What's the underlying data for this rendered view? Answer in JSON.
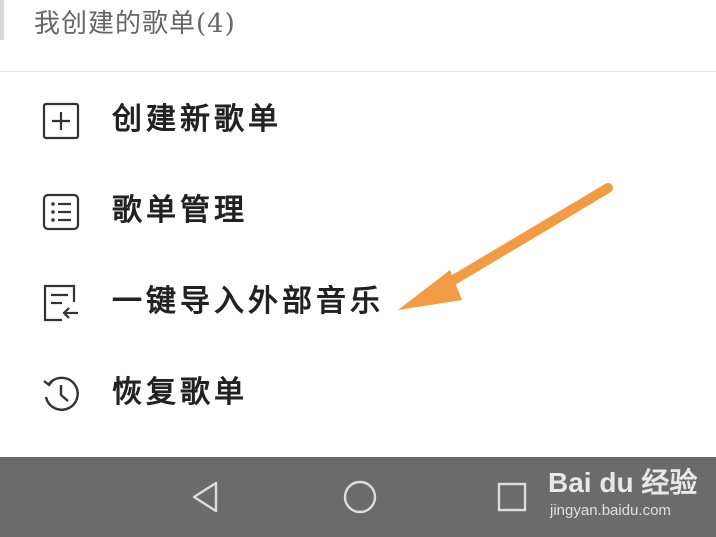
{
  "header": {
    "title": "我创建的歌单(4)"
  },
  "menu": {
    "items": [
      {
        "label": "创建新歌单",
        "icon": "add-square-icon"
      },
      {
        "label": "歌单管理",
        "icon": "list-icon"
      },
      {
        "label": "一键导入外部音乐",
        "icon": "import-icon"
      },
      {
        "label": "恢复歌单",
        "icon": "history-icon"
      }
    ]
  },
  "annotation": {
    "arrow_color": "#f39a45"
  },
  "navbar": {
    "background": "#6b6b6b",
    "buttons": [
      "back-icon",
      "home-icon",
      "recents-icon"
    ]
  },
  "watermark": {
    "brand": "Bai du 经验",
    "url": "jingyan.baidu.com"
  }
}
